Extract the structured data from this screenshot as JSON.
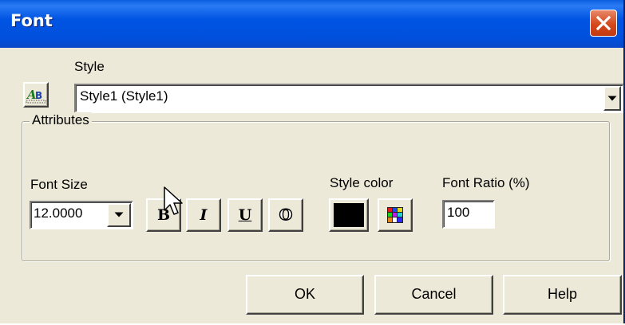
{
  "window": {
    "title": "Font"
  },
  "style": {
    "label": "Style",
    "selected": "Style1 (Style1)"
  },
  "attributes": {
    "group_label": "Attributes",
    "font_size": {
      "label": "Font Size",
      "value": "12.0000"
    },
    "format_buttons": {
      "bold": "B",
      "italic": "I",
      "underline": "U",
      "outline": "O"
    },
    "style_color": {
      "label": "Style color",
      "color": "#000000"
    },
    "font_ratio": {
      "label": "Font Ratio (%)",
      "value": "100"
    }
  },
  "buttons": {
    "ok": "OK",
    "cancel": "Cancel",
    "help": "Help"
  },
  "colors": {
    "titlebar": "#0054E3",
    "dialog_bg": "#ECE9D8",
    "close": "#D4491C"
  }
}
